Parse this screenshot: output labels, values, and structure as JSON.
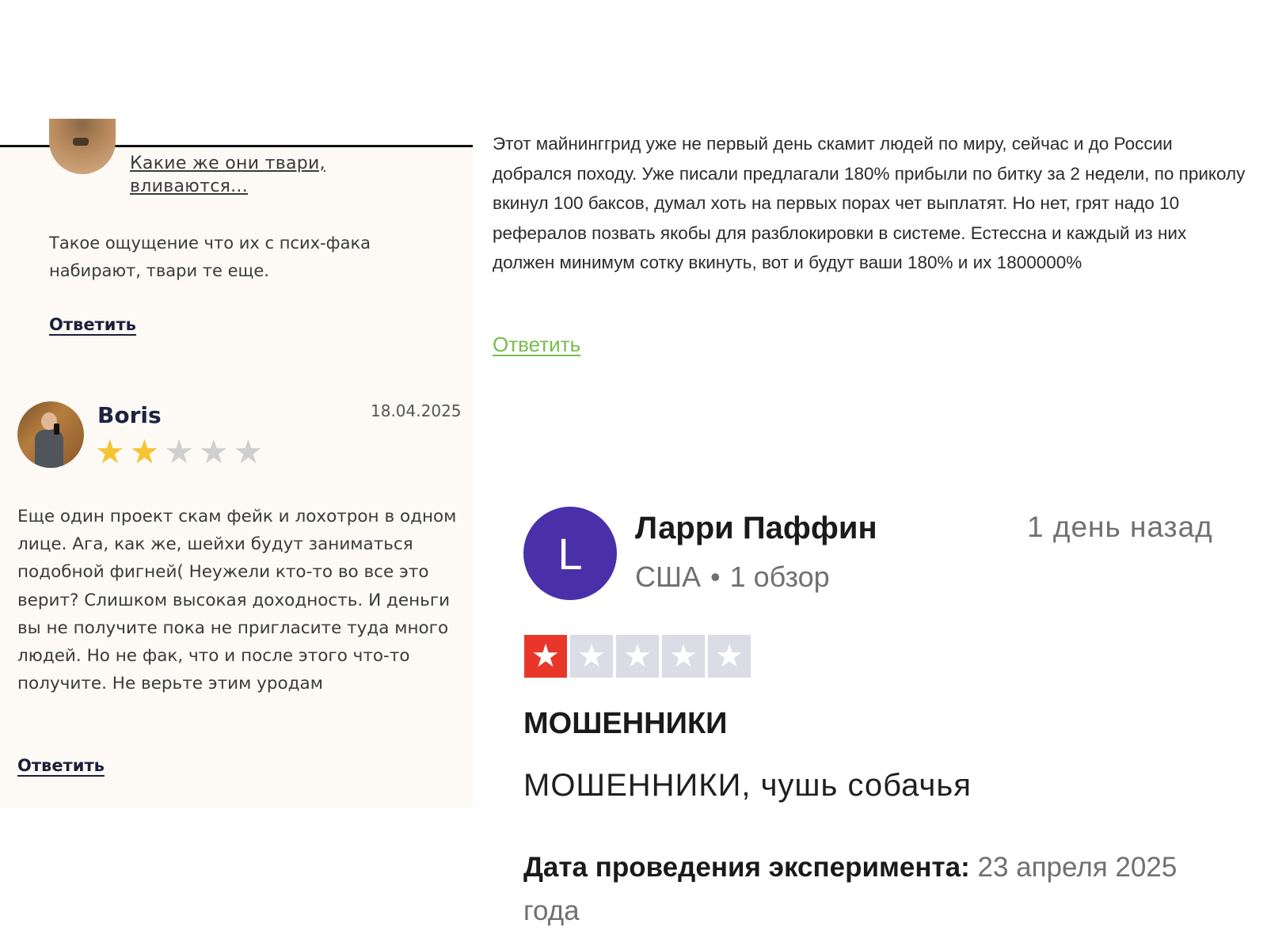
{
  "left": {
    "comment1": {
      "reply_title": "Какие же они твари, вливаются...",
      "text": "Такое ощущение что их с псих-фака набирают, твари те еще.",
      "reply_label": "Ответить"
    },
    "comment2": {
      "author": "Boris",
      "date": "18.04.2025",
      "rating": 2,
      "rating_max": 5,
      "text": "Еще один проект скам фейк и лохотрон в одном лице. Ага, как же, шейхи будут заниматься подобной фигней( Неужели кто-то во все это верит? Слишком высокая доходность. И деньги вы не получите пока не пригласите туда много людей. Но не фак, что и после этого что-то получите. Не верьте этим уродам",
      "reply_label": "Ответить"
    }
  },
  "right_top": {
    "text": "Этот майнинггрид уже не первый день скамит людей по миру, сейчас и до России добрался походу. Уже писали предлагали 180% прибыли по битку за 2 недели, по приколу вкинул 100 баксов, думал хоть на первых порах чет выплатят. Но нет, грят надо 10 рефералов позвать якобы для разблокировки в системе. Естессна и каждый из них должен минимум сотку вкинуть, вот и будут ваши 180% и их 1800000%",
    "reply_label": "Ответить"
  },
  "right_bottom": {
    "avatar_letter": "L",
    "author": "Ларри Паффин",
    "country": "США",
    "separator": "•",
    "reviews": "1 обзор",
    "time_ago": "1 день назад",
    "rating": 1,
    "rating_max": 5,
    "title": "МОШЕННИКИ",
    "body": "МОШЕННИКИ, чушь собачья",
    "experience_label": "Дата проведения эксперимента:",
    "experience_value": "23 апреля 2025 года"
  },
  "colors": {
    "left_bg": "#fdfaf6",
    "star_on": "#f5c430",
    "star_off": "#cfcfcf",
    "reply_green": "#78bd4b",
    "avatar_purple": "#4a30a8",
    "tp_red": "#e8372a",
    "tp_grey": "#dcdce6"
  }
}
